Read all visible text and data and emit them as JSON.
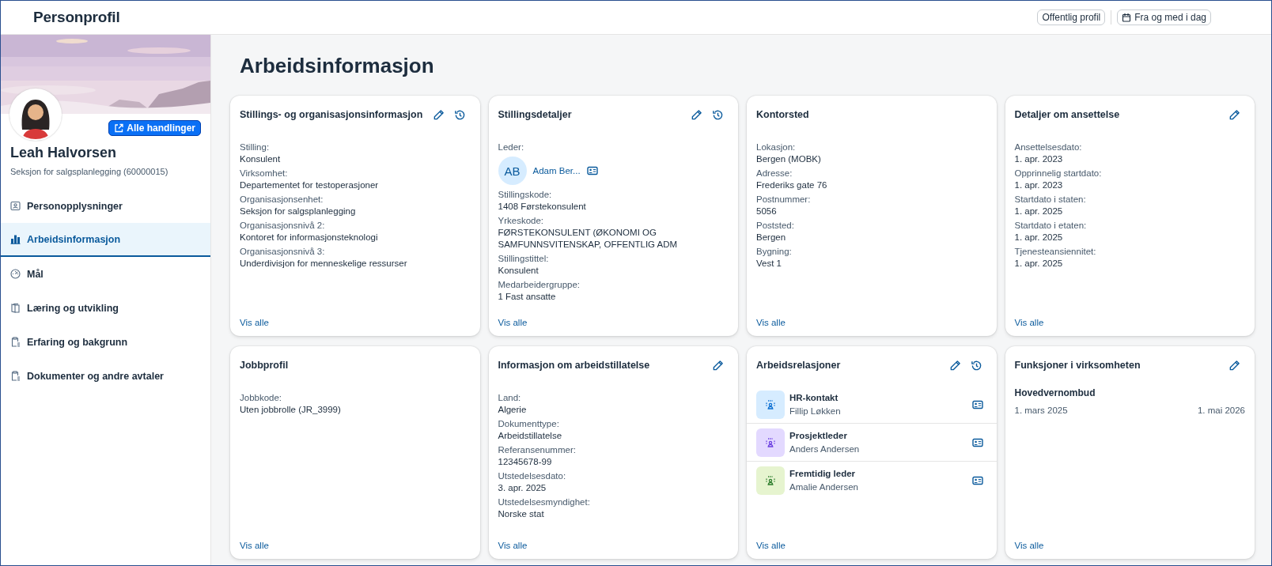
{
  "header": {
    "title": "Personprofil",
    "buttons": [
      {
        "label": "Offentlig profil"
      },
      {
        "label": "Fra og med i dag"
      }
    ]
  },
  "profile": {
    "action_button": "Alle handlinger",
    "name": "Leah Halvorsen",
    "subtitle": "Seksjon for salgsplanlegging (60000015)"
  },
  "nav": [
    {
      "label": "Personopplysninger",
      "selected": false
    },
    {
      "label": "Arbeidsinformasjon",
      "selected": true
    },
    {
      "label": "Mål",
      "selected": false
    },
    {
      "label": "Læring og utvikling",
      "selected": false
    },
    {
      "label": "Erfaring og bakgrunn",
      "selected": false
    },
    {
      "label": "Dokumenter og andre avtaler",
      "selected": false
    }
  ],
  "page_title": "Arbeidsinformasjon",
  "cards": [
    {
      "title": "Stillings- og organisasjonsinformasjon",
      "editable": true,
      "history": true,
      "link": "Vis alle",
      "items": [
        {
          "kind": "field",
          "label": "Stilling:",
          "value": "Konsulent"
        },
        {
          "kind": "field",
          "label": "Virksomhet:",
          "value": "Departementet for testoperasjoner"
        },
        {
          "kind": "field",
          "label": "Organisasjonsenhet:",
          "value": "Seksjon for salgsplanlegging"
        },
        {
          "kind": "field",
          "label": "Organisasjonsnivå 2:",
          "value": "Kontoret for informasjonsteknologi"
        },
        {
          "kind": "field",
          "label": "Organisasjonsnivå 3:",
          "value": "Underdivisjon for menneskelige ressurser"
        }
      ]
    },
    {
      "title": "Stillingsdetaljer",
      "editable": true,
      "history": true,
      "link": "Vis alle",
      "items": [
        {
          "kind": "person",
          "label": "Leder:",
          "initials": "AB",
          "name": "Adam Ber..."
        },
        {
          "kind": "field",
          "label": "Stillingskode:",
          "value": "1408 Førstekonsulent"
        },
        {
          "kind": "field",
          "label": "Yrkeskode:",
          "value": "FØRSTEKONSULENT (ØKONOMI OG SAMFUNNSVITENSKAP, OFFENTLIG ADM"
        },
        {
          "kind": "field",
          "label": "Stillingstittel:",
          "value": "Konsulent"
        },
        {
          "kind": "field",
          "label": "Medarbeidergruppe:",
          "value": "1 Fast ansatte"
        }
      ]
    },
    {
      "title": "Kontorsted",
      "editable": false,
      "history": false,
      "link": "Vis alle",
      "items": [
        {
          "kind": "field",
          "label": "Lokasjon:",
          "value": "Bergen (MOBK)"
        },
        {
          "kind": "field",
          "label": "Adresse:",
          "value": "Frederiks gate 76"
        },
        {
          "kind": "field",
          "label": "Postnummer:",
          "value": "5056"
        },
        {
          "kind": "field",
          "label": "Poststed:",
          "value": "Bergen"
        },
        {
          "kind": "field",
          "label": "Bygning:",
          "value": "Vest 1"
        }
      ]
    },
    {
      "title": "Detaljer om ansettelse",
      "editable": true,
      "history": false,
      "link": "Vis alle",
      "items": [
        {
          "kind": "field",
          "label": "Ansettelsesdato:",
          "value": "1. apr. 2023"
        },
        {
          "kind": "field",
          "label": "Opprinnelig startdato:",
          "value": "1. apr. 2023"
        },
        {
          "kind": "field",
          "label": "Startdato i staten:",
          "value": "1. apr. 2025"
        },
        {
          "kind": "field",
          "label": "Startdato i etaten:",
          "value": "1. apr. 2025"
        },
        {
          "kind": "field",
          "label": "Tjenesteansiennitet:",
          "value": "1. apr. 2025"
        }
      ]
    },
    {
      "title": "Jobbprofil",
      "editable": false,
      "history": false,
      "link": "Vis alle",
      "items": [
        {
          "kind": "field",
          "label": "Jobbkode:",
          "value": "Uten jobbrolle (JR_3999)"
        }
      ]
    },
    {
      "title": "Informasjon om arbeidstillatelse",
      "editable": true,
      "history": false,
      "link": "Vis alle",
      "items": [
        {
          "kind": "field",
          "label": "Land:",
          "value": "Algerie"
        },
        {
          "kind": "field",
          "label": "Dokumenttype:",
          "value": "Arbeidstillatelse"
        },
        {
          "kind": "field",
          "label": "Referansenummer:",
          "value": "12345678-99"
        },
        {
          "kind": "field",
          "label": "Utstedelsesdato:",
          "value": "3. apr. 2025"
        },
        {
          "kind": "field",
          "label": "Utstedelsesmyndighet:",
          "value": "Norske stat"
        }
      ]
    },
    {
      "title": "Arbeidsrelasjoner",
      "editable": true,
      "history": true,
      "link": "Vis alle",
      "items": [
        {
          "kind": "relation",
          "title": "HR-kontakt",
          "name": "Fillip Løkken",
          "color": "#d6ecff"
        },
        {
          "kind": "relation",
          "title": "Prosjektleder",
          "name": "Anders Andersen",
          "color": "#e3d9ff"
        },
        {
          "kind": "relation",
          "title": "Fremtidig leder",
          "name": "Amalie Andersen",
          "color": "#e6f4cf"
        }
      ]
    },
    {
      "title": "Funksjoner i virksomheten",
      "editable": true,
      "history": false,
      "link": "Vis alle",
      "items": [
        {
          "kind": "function",
          "title": "Hovedvernombud",
          "start": "1. mars 2025",
          "end": "1. mai 2026"
        }
      ]
    }
  ]
}
